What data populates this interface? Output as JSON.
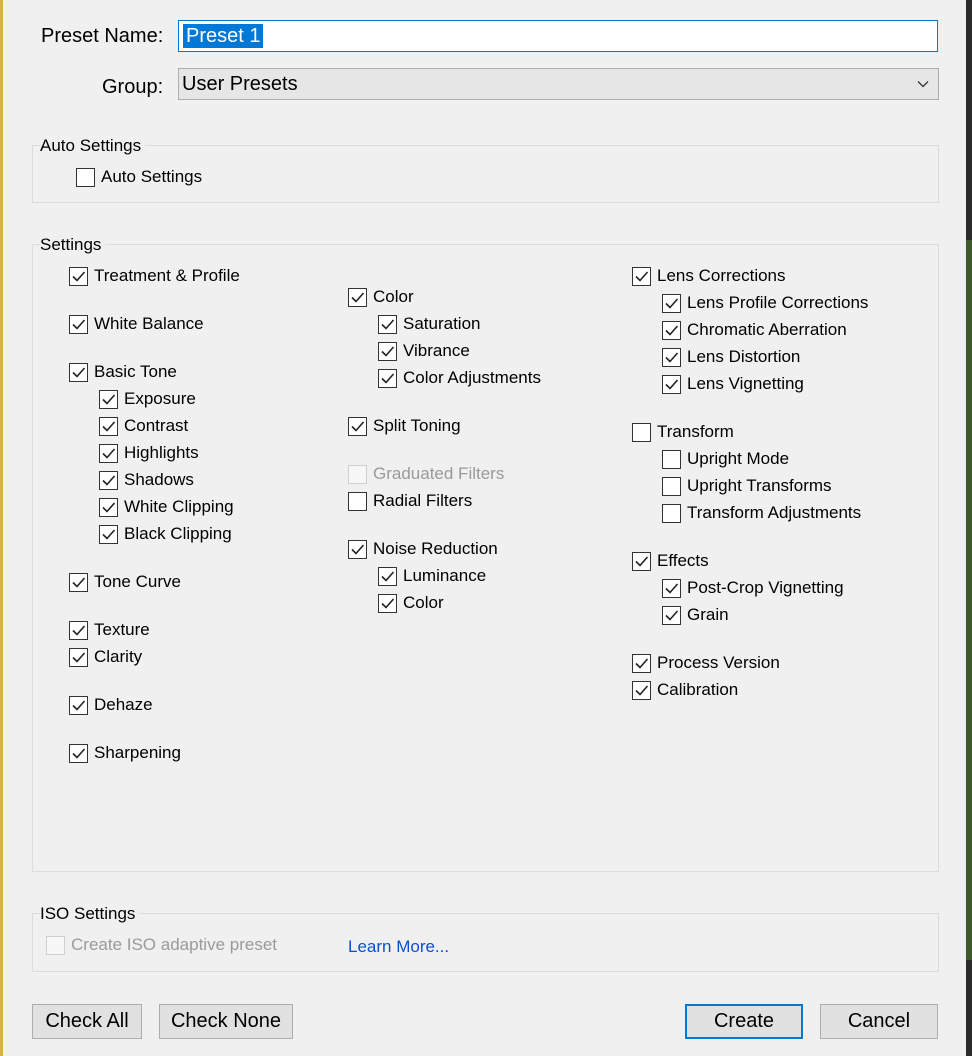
{
  "preset_name": {
    "label": "Preset Name:",
    "value": "Preset 1"
  },
  "group": {
    "label": "Group:",
    "value": "User Presets"
  },
  "auto_settings": {
    "legend": "Auto Settings",
    "checkbox": {
      "label": "Auto Settings",
      "checked": false
    }
  },
  "settings": {
    "legend": "Settings",
    "col1": [
      {
        "label": "Treatment & Profile",
        "checked": true
      },
      {
        "label": "White Balance",
        "checked": true
      },
      {
        "label": "Basic Tone",
        "checked": true
      },
      {
        "label": "Exposure",
        "checked": true
      },
      {
        "label": "Contrast",
        "checked": true
      },
      {
        "label": "Highlights",
        "checked": true
      },
      {
        "label": "Shadows",
        "checked": true
      },
      {
        "label": "White Clipping",
        "checked": true
      },
      {
        "label": "Black Clipping",
        "checked": true
      },
      {
        "label": "Tone Curve",
        "checked": true
      },
      {
        "label": "Texture",
        "checked": true
      },
      {
        "label": "Clarity",
        "checked": true
      },
      {
        "label": "Dehaze",
        "checked": true
      },
      {
        "label": "Sharpening",
        "checked": true
      }
    ],
    "col2": [
      {
        "label": "Color",
        "checked": true
      },
      {
        "label": "Saturation",
        "checked": true
      },
      {
        "label": "Vibrance",
        "checked": true
      },
      {
        "label": "Color Adjustments",
        "checked": true
      },
      {
        "label": "Split Toning",
        "checked": true
      },
      {
        "label": "Graduated Filters",
        "checked": false,
        "disabled": true
      },
      {
        "label": "Radial Filters",
        "checked": false
      },
      {
        "label": "Noise Reduction",
        "checked": true
      },
      {
        "label": "Luminance",
        "checked": true
      },
      {
        "label": "Color",
        "checked": true
      }
    ],
    "col3": [
      {
        "label": "Lens Corrections",
        "checked": true
      },
      {
        "label": "Lens Profile Corrections",
        "checked": true
      },
      {
        "label": "Chromatic Aberration",
        "checked": true
      },
      {
        "label": "Lens Distortion",
        "checked": true
      },
      {
        "label": "Lens Vignetting",
        "checked": true
      },
      {
        "label": "Transform",
        "checked": false
      },
      {
        "label": "Upright Mode",
        "checked": false
      },
      {
        "label": "Upright Transforms",
        "checked": false
      },
      {
        "label": "Transform Adjustments",
        "checked": false
      },
      {
        "label": "Effects",
        "checked": true
      },
      {
        "label": "Post-Crop Vignetting",
        "checked": true
      },
      {
        "label": "Grain",
        "checked": true
      },
      {
        "label": "Process Version",
        "checked": true
      },
      {
        "label": "Calibration",
        "checked": true
      }
    ]
  },
  "iso_settings": {
    "legend": "ISO Settings",
    "checkbox": {
      "label": "Create ISO adaptive preset",
      "checked": false,
      "disabled": true
    },
    "learn_more": "Learn More..."
  },
  "buttons": {
    "check_all": "Check All",
    "check_none": "Check None",
    "create": "Create",
    "cancel": "Cancel"
  }
}
